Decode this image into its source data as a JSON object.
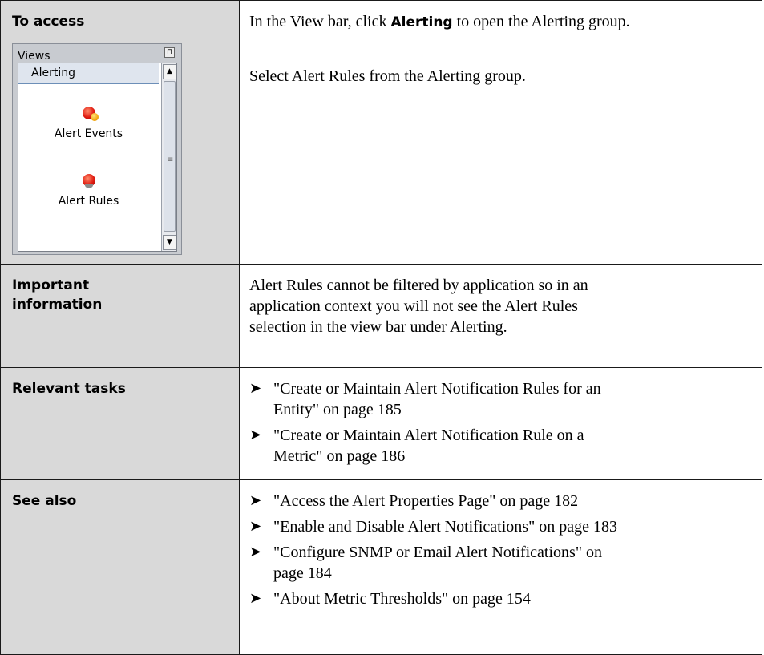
{
  "rows": {
    "access": {
      "heading": "To access",
      "line1_pre": "In the View bar, click ",
      "line1_bold": "Alerting",
      "line1_post": " to open the Alerting group.",
      "line2": "Select Alert Rules from the Alerting group."
    },
    "important": {
      "heading_l1": "Important",
      "heading_l2": "information",
      "text_l1": "Alert Rules cannot be filtered by application so in an",
      "text_l2": "application context you will not see the Alert Rules",
      "text_l3": "selection in the view bar under Alerting."
    },
    "tasks": {
      "heading": "Relevant tasks",
      "items": [
        {
          "l1": "\"Create or Maintain Alert Notification Rules for an",
          "l2": "Entity\" on page 185"
        },
        {
          "l1": "\"Create or Maintain Alert Notification Rule on a",
          "l2": "Metric\" on page 186"
        }
      ]
    },
    "see_also": {
      "heading": "See also",
      "items": [
        {
          "l1": "\"Access the Alert Properties Page\" on page 182"
        },
        {
          "l1": "\"Enable and Disable Alert Notifications\" on page 183"
        },
        {
          "l1": "\"Configure SNMP or Email Alert Notifications\" on",
          "l2": "page 184"
        },
        {
          "l1": "\"About Metric Thresholds\" on page 154"
        }
      ]
    }
  },
  "views_panel": {
    "title": "Views",
    "group": "Alerting",
    "items": [
      {
        "label": "Alert Events",
        "icon": "alert-events-icon"
      },
      {
        "label": "Alert Rules",
        "icon": "alert-rules-icon"
      }
    ]
  },
  "bullet_glyph": "➤"
}
